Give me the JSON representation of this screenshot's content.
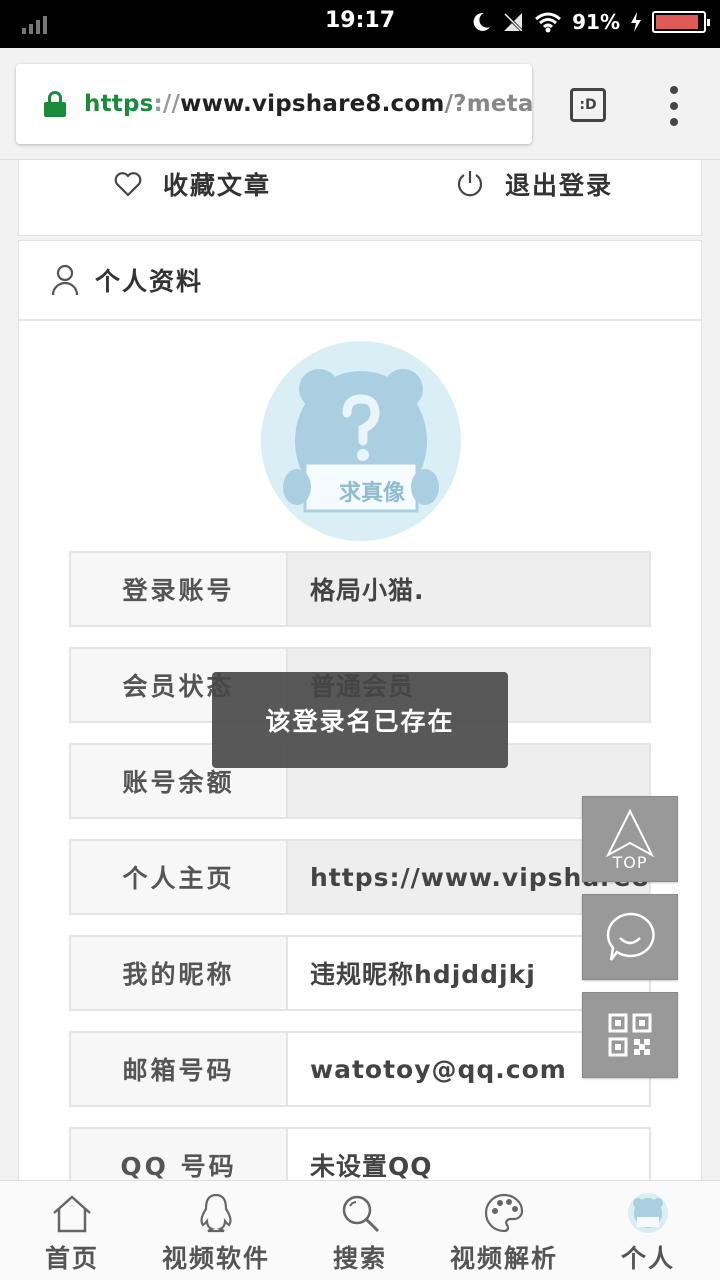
{
  "status_bar": {
    "time": "19:17",
    "battery": "91%"
  },
  "browser": {
    "url_scheme": "https",
    "url_separator": "://",
    "url_host": "www.vipshare8.com",
    "url_path": "/?meta&n",
    "tab_button_label": ":D"
  },
  "top_actions": {
    "favorite_label": "收藏文章",
    "logout_label": "退出登录"
  },
  "profile": {
    "section_title": "个人资料",
    "avatar_text_1": "求真",
    "avatar_text_2": "像",
    "fields": [
      {
        "label": "登录账号",
        "value": "格局小猫."
      },
      {
        "label": "会员状态",
        "value": "普通会员"
      },
      {
        "label": "账号余额",
        "value": ""
      },
      {
        "label": "个人主页",
        "value": "https://www.vipshare8.co"
      },
      {
        "label": "我的昵称",
        "value": "违规昵称hdjddjkj"
      },
      {
        "label": "邮箱号码",
        "value": "watotoy@qq.com"
      },
      {
        "label": "QQ 号码",
        "value": "未设置QQ"
      }
    ]
  },
  "toast": {
    "message": "该登录名已存在"
  },
  "floating": {
    "top_label": "TOP"
  },
  "bottom_nav": {
    "items": [
      {
        "label": "首页",
        "icon": "home-icon"
      },
      {
        "label": "视频软件",
        "icon": "penguin-icon"
      },
      {
        "label": "搜索",
        "icon": "search-icon"
      },
      {
        "label": "视频解析",
        "icon": "palette-icon"
      },
      {
        "label": "个人",
        "icon": "avatar-icon"
      }
    ]
  }
}
